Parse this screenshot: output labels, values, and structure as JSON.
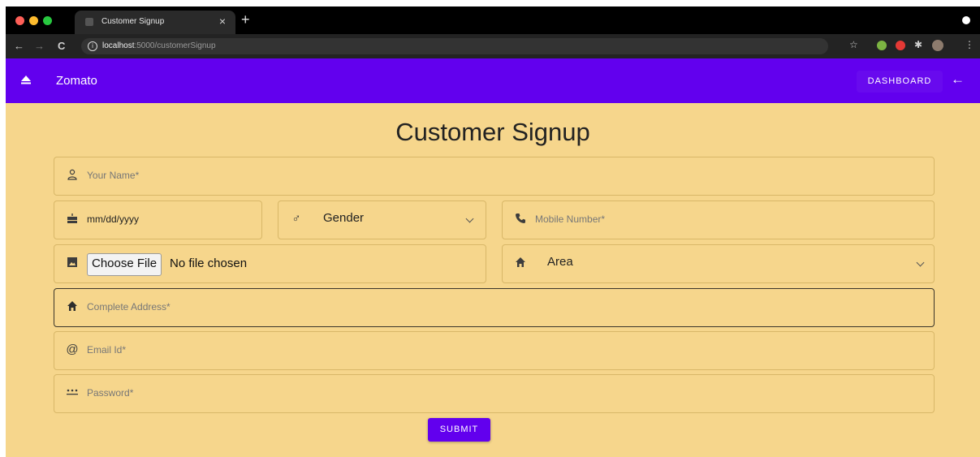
{
  "browser": {
    "tab_title": "Customer Signup",
    "tab_close": "×",
    "new_tab": "+",
    "url_host": "localhost",
    "url_path": ":5000/customerSignup"
  },
  "appbar": {
    "title": "Zomato",
    "dashboard_label": "DASHBOARD",
    "back_arrow": "←"
  },
  "form": {
    "title": "Customer Signup",
    "name_placeholder": "Your Name*",
    "dob_placeholder": "mm/dd/yyyy",
    "gender_value": "Gender",
    "mobile_placeholder": "Mobile Number*",
    "choose_file_label": "Choose File",
    "no_file_text": "No file chosen",
    "area_value": "Area",
    "address_placeholder": "Complete Address*",
    "email_placeholder": "Email Id*",
    "password_placeholder": "Password*",
    "submit_label": "SUBMIT"
  },
  "colors": {
    "primary": "#6200ee",
    "background": "#f6d68c"
  },
  "icons": {
    "name": "person-icon",
    "dob": "cake-icon",
    "gender": "male-icon",
    "mobile": "phone-icon",
    "image": "image-icon",
    "area": "home-icon",
    "address": "home-icon",
    "email": "at-icon",
    "password": "password-icon"
  }
}
